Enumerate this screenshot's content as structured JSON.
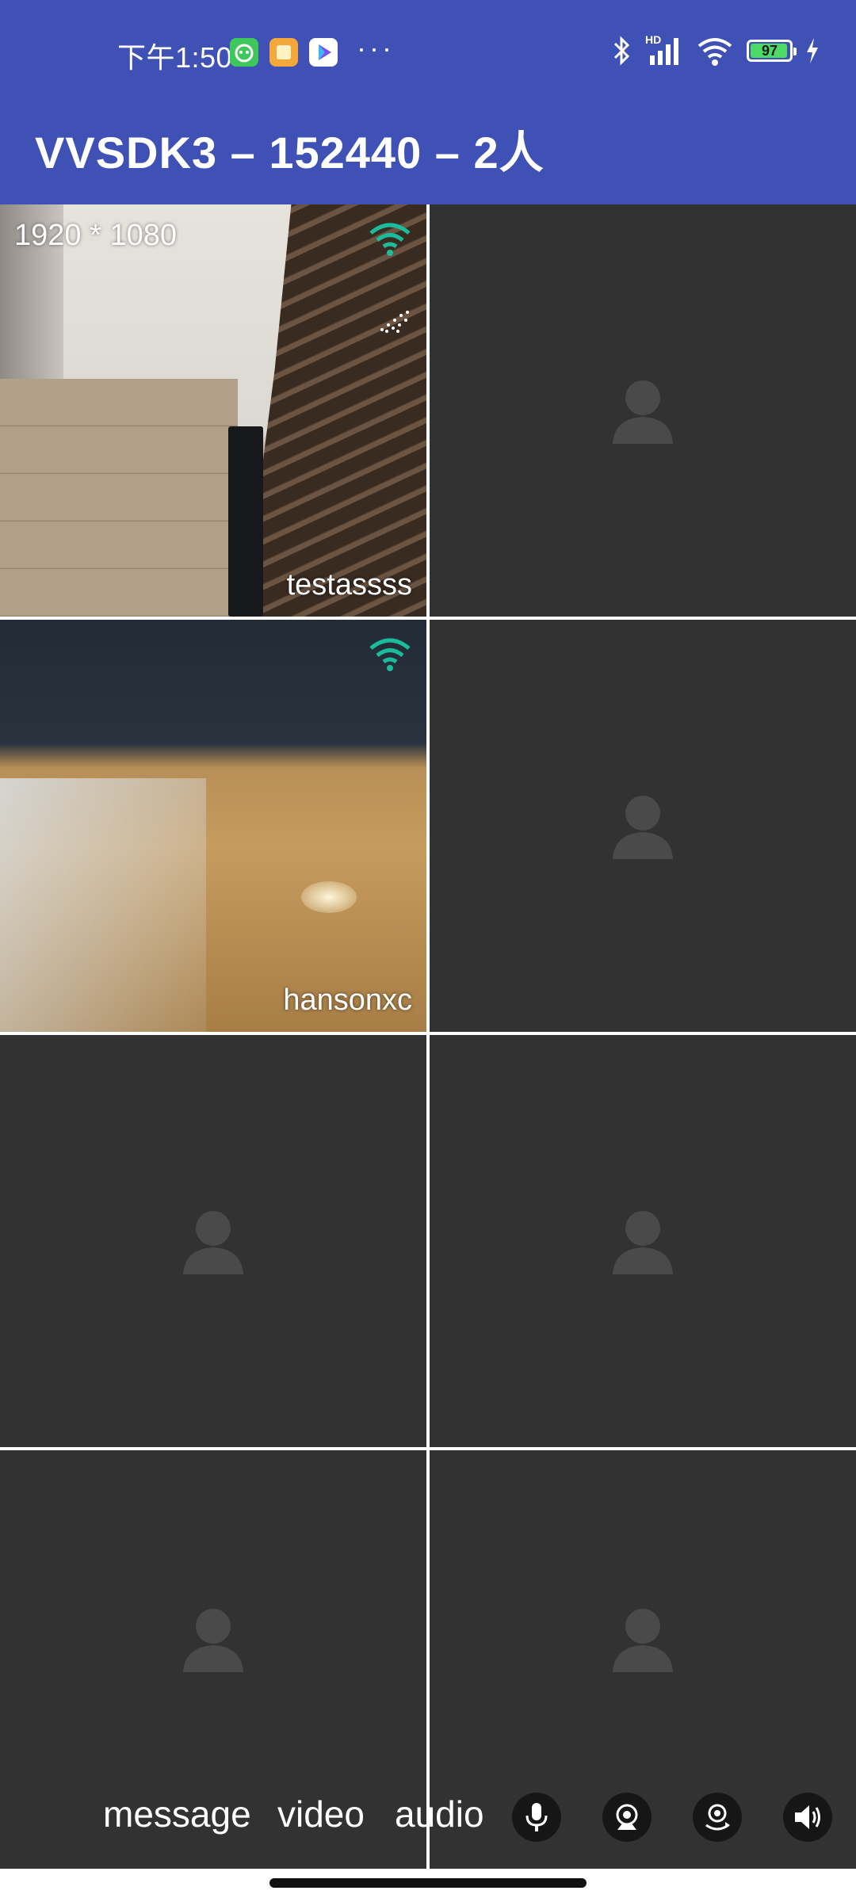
{
  "status_bar": {
    "time": "下午1:50",
    "overflow": "···",
    "network": "HD",
    "battery": "97",
    "icons": [
      "cat-app-icon",
      "orange-app-icon",
      "play-app-icon",
      "bluetooth-icon",
      "signal-icon",
      "wifi-icon",
      "battery-icon",
      "charging-icon"
    ]
  },
  "titlebar": {
    "title": "VVSDK3 – 152440 – 2人"
  },
  "tiles": [
    {
      "name": "testassss",
      "resolution": "1920 * 1080",
      "has_video": true
    },
    {
      "name": "",
      "has_video": false
    },
    {
      "name": "hansonxc",
      "has_video": true
    },
    {
      "name": "",
      "has_video": false
    },
    {
      "name": "",
      "has_video": false
    },
    {
      "name": "",
      "has_video": false
    },
    {
      "name": "",
      "has_video": false
    },
    {
      "name": "",
      "has_video": false
    }
  ],
  "controls": {
    "message": "message",
    "video": "video",
    "audio": "audio",
    "icons": [
      "microphone-icon",
      "camera-icon",
      "switch-camera-icon",
      "speaker-icon"
    ]
  },
  "colors": {
    "appbar": "#3f51b5",
    "tile_bg": "#323232",
    "signal_green": "#1abc9c"
  }
}
